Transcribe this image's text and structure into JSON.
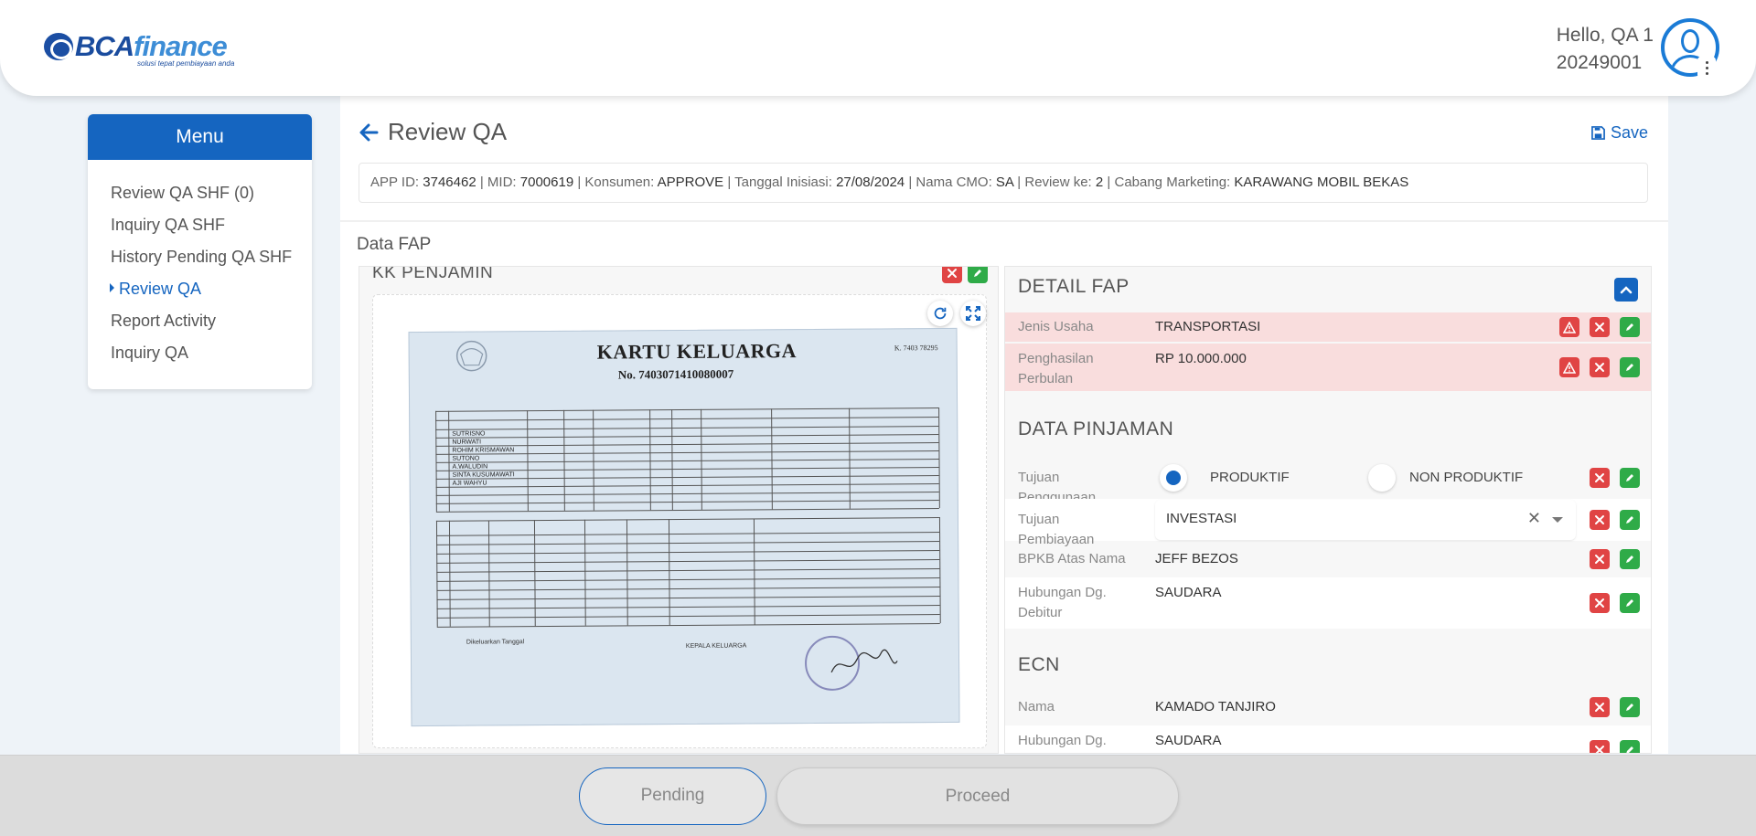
{
  "header": {
    "brand_bca": "BCA",
    "brand_finance": "finance",
    "brand_tagline": "solusi tepat pembiayaan anda",
    "greeting": "Hello, QA 1",
    "user_id": "20249001"
  },
  "sidebar": {
    "title": "Menu",
    "items": [
      {
        "label": "Review QA SHF (0)"
      },
      {
        "label": "Inquiry QA SHF"
      },
      {
        "label": "History Pending QA SHF"
      },
      {
        "label": "Review QA"
      },
      {
        "label": "Report Activity"
      },
      {
        "label": "Inquiry QA"
      }
    ]
  },
  "page": {
    "title": "Review QA",
    "save_label": "Save",
    "info": {
      "app_id_label": "APP ID:",
      "app_id": "3746462",
      "mid_label": "MID:",
      "mid": "7000619",
      "konsumen_label": "Konsumen:",
      "konsumen": "APPROVE",
      "tanggal_label": "Tanggal Inisiasi:",
      "tanggal": "27/08/2024",
      "cmo_label": "Nama CMO:",
      "cmo": "SA",
      "review_label": "Review ke:",
      "review": "2",
      "cabang_label": "Cabang Marketing:",
      "cabang": "KARAWANG MOBIL BEKAS",
      "separator": "|"
    },
    "section_label": "Data FAP"
  },
  "document": {
    "title": "KK PENJAMIN",
    "kk_title": "KARTU KELUARGA",
    "kk_number": "No. 7403071410080007",
    "kk_corner": "K. 7403 78295"
  },
  "detail": {
    "detail_fap_title": "DETAIL FAP",
    "jenis_usaha_label": "Jenis Usaha",
    "jenis_usaha_value": "TRANSPORTASI",
    "penghasilan_label": "Penghasilan Perbulan",
    "penghasilan_value": "RP 10.000.000",
    "data_pinjaman_title": "DATA PINJAMAN",
    "tujuan_penggunaan_label": "Tujuan Penggunaan",
    "radio_produktif": "PRODUKTIF",
    "radio_non_produktif": "NON PRODUKTIF",
    "tujuan_pembiayaan_label": "Tujuan Pembiayaan",
    "tujuan_pembiayaan_value": "INVESTASI",
    "bpkb_label": "BPKB Atas Nama",
    "bpkb_value": "JEFF BEZOS",
    "hubungan_label": "Hubungan Dg. Debitur",
    "hubungan_value": "SAUDARA",
    "ecn_title": "ECN",
    "ecn_nama_label": "Nama",
    "ecn_nama_value": "KAMADO TANJIRO",
    "ecn_hubungan_label": "Hubungan Dg.",
    "ecn_hubungan_value": "SAUDARA"
  },
  "footer": {
    "pending_label": "Pending",
    "proceed_label": "Proceed"
  },
  "colors": {
    "accent": "#1565c0",
    "danger": "#e04444",
    "success": "#2fab48",
    "warn_row": "#f9dddd"
  }
}
